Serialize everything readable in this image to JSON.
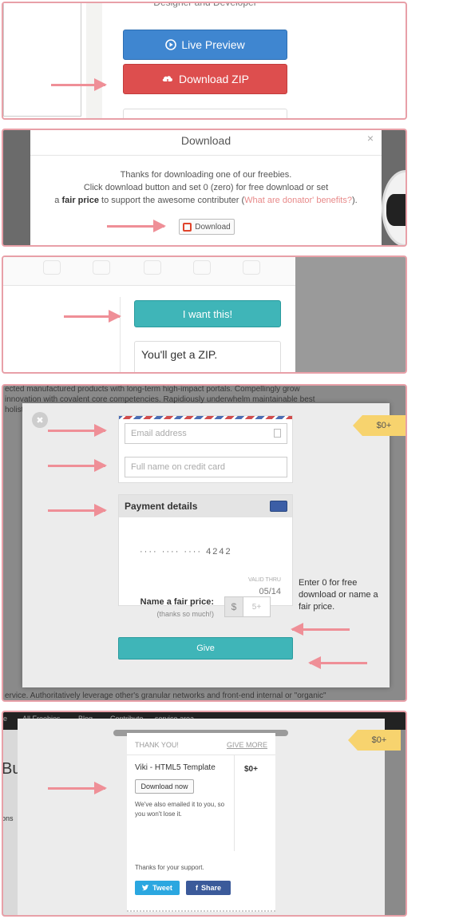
{
  "panel1": {
    "subtitle": "Designer and Developer",
    "live_preview_label": "Live Preview",
    "download_zip_label": "Download ZIP"
  },
  "panel2": {
    "modal_title": "Download",
    "close_glyph": "×",
    "line1": "Thanks for downloading one of our freebies.",
    "line2": "Click download button and set 0 (zero) for free download or set",
    "line3_prefix": "a ",
    "line3_bold": "fair price",
    "line3_mid": " to support the awesome contributer (",
    "line3_link": "What are donator' benefits?",
    "line3_suffix": ").",
    "download_button_label": "Download"
  },
  "panel3": {
    "want_button_label": "I want this!",
    "zip_text": "You'll get a ZIP."
  },
  "panel4": {
    "bg_top_lines": [
      "ected manufactured products with long-term high-impact portals. Compellingly grow",
      " innovation with covalent core competencies. Rapidiously underwhelm maintainable best",
      " holist"
    ],
    "bg_bottom_line": "ervice. Authoritatively leverage other's granular networks and front-end internal or \"organic\"",
    "close_glyph": "✖",
    "price_tag": "$0+",
    "email_placeholder": "Email address",
    "name_placeholder": "Full name on credit card",
    "payment_title": "Payment details",
    "card_number": "···· ···· ···· 4242",
    "valid_thru": "VALID THRU",
    "expiry": "05/14",
    "enter_zero": "Enter 0 for free download or name a fair price.",
    "fair_price_label": "Name a fair price:",
    "fair_price_sub": "(thanks so much!)",
    "currency": "$",
    "amount_placeholder": "5+",
    "give_label": "Give"
  },
  "panel5": {
    "nav": [
      "e",
      "All Freebies",
      "Blog",
      "Contribute",
      "service area"
    ],
    "page_letters": "Bu",
    "page_side": "ons",
    "price_tag": "$0+",
    "thank_you": "THANK YOU!",
    "give_more": "GIVE MORE",
    "product": "Viki - HTML5 Template",
    "product_price": "$0+",
    "download_now": "Download now",
    "emailed": "We've also emailed it to you, so you won't lose it.",
    "thanks_support": "Thanks for your support.",
    "tweet_label": "Tweet",
    "share_label": "Share"
  }
}
